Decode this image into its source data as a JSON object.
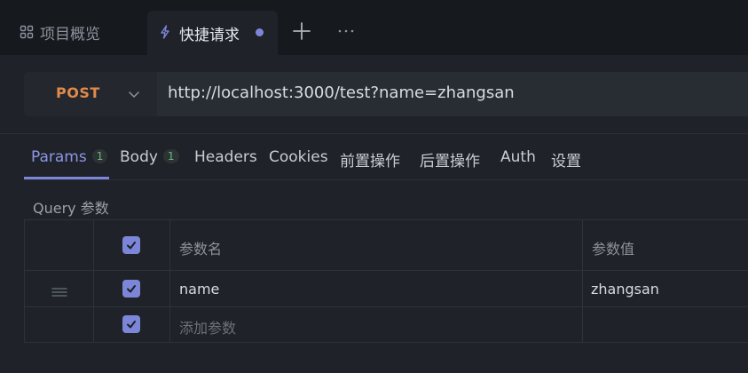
{
  "tabs": {
    "overview_label": "项目概览",
    "active_label": "快捷请求",
    "add_symbol": "+",
    "more_symbol": "···"
  },
  "request": {
    "method": "POST",
    "url": "http://localhost:3000/test?name=zhangsan"
  },
  "subtabs": {
    "params_label": "Params",
    "params_count": "1",
    "body_label": "Body",
    "body_count": "1",
    "headers_label": "Headers",
    "cookies_label": "Cookies",
    "pre_label": "前置操作",
    "post_label": "后置操作",
    "auth_label": "Auth",
    "settings_label": "设置"
  },
  "query": {
    "title": "Query 参数",
    "header_name": "参数名",
    "header_value": "参数值",
    "rows": [
      {
        "name": "name",
        "value": "zhangsan",
        "checked": true
      }
    ],
    "add_placeholder": "添加参数"
  },
  "colors": {
    "accent": "#7c86d8",
    "method": "#e08a4b",
    "badge": "#6fb48a"
  }
}
